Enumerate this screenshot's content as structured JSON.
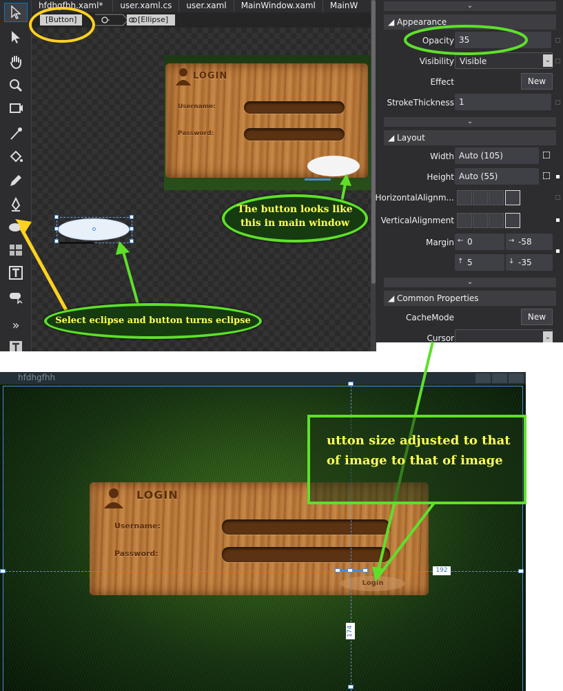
{
  "designer": {
    "tabs": [
      "hfdhgfhh.xaml*",
      "user.xaml.cs",
      "user.xaml",
      "MainWindow.xaml",
      "MainW"
    ],
    "breadcrumb": {
      "button": "[Button]",
      "ellipse": "[Ellipse]"
    },
    "login_card": {
      "title": "LOGIN",
      "username_label": "Username:",
      "password_label": "Password:"
    }
  },
  "properties": {
    "appearance": {
      "header": "Appearance",
      "opacity": {
        "label": "Opacity",
        "value": "35"
      },
      "visibility": {
        "label": "Visibility",
        "value": "Visible"
      },
      "effect": {
        "label": "Effect",
        "button": "New"
      },
      "stroke": {
        "label": "StrokeThickness",
        "value": "1"
      }
    },
    "layout": {
      "header": "Layout",
      "width": {
        "label": "Width",
        "value": "Auto (105)"
      },
      "height": {
        "label": "Height",
        "value": "Auto (55)"
      },
      "halign": {
        "label": "HorizontalAlignm..."
      },
      "valign": {
        "label": "VerticalAlignment"
      },
      "margin": {
        "label": "Margin",
        "left": "0",
        "right": "-58",
        "top": "5",
        "bottom": "-35"
      }
    },
    "common": {
      "header": "Common Properties",
      "cachemode": {
        "label": "CacheMode",
        "button": "New"
      },
      "cursor": {
        "label": "Cursor",
        "value": ""
      }
    }
  },
  "main_window": {
    "title": "hfdhgfhh",
    "login_card": {
      "title": "LOGIN",
      "username_label": "Username:",
      "password_label": "Password:",
      "button_label": "Login"
    },
    "measure_width": "192",
    "measure_height": "174"
  },
  "annotations": {
    "main_window_note": "The button looks like this in main window",
    "select_note": "Select eclipse and button turns eclipse",
    "size_note": "utton size adjusted to that of  image to  that of image"
  },
  "colors": {
    "annotation_green": "#5ee02a",
    "annotation_yellow": "#ffd21f",
    "annotation_text": "#ffff55",
    "selection_blue": "#4a8cd8"
  }
}
